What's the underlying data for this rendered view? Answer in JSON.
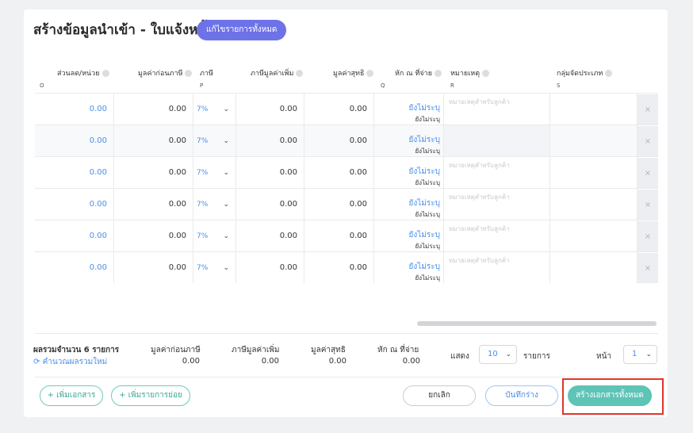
{
  "page": {
    "title": "สร้างข้อมูลนำเข้า - ใบแจ้งหนี้",
    "edit_all_button": "แก้ไขรายการทั้งหมด"
  },
  "table": {
    "headers": [
      {
        "label": "ส่วนลด/หน่วย",
        "letter": "O"
      },
      {
        "label": "มูลค่าก่อนภาษี",
        "letter": ""
      },
      {
        "label": "ภาษี",
        "letter": "P"
      },
      {
        "label": "ภาษีมูลค่าเพิ่ม",
        "letter": ""
      },
      {
        "label": "มูลค่าสุทธิ",
        "letter": ""
      },
      {
        "label": "หัก ณ ที่จ่าย",
        "letter": "Q"
      },
      {
        "label": "หมายเหตุ",
        "letter": "R"
      },
      {
        "label": "กลุ่มจัดประเภท",
        "letter": "S"
      }
    ],
    "rows": [
      {
        "discount": "0.00",
        "pretax": "0.00",
        "vat_rate": "7%",
        "vat": "0.00",
        "net": "0.00",
        "withholding": "ยังไม่ระบุ",
        "withholding_sub": "ยังไม่ระบุ",
        "note_placeholder": "หมายเหตุสำหรับลูกค้า",
        "delete": "×"
      },
      {
        "discount": "0.00",
        "pretax": "0.00",
        "vat_rate": "7%",
        "vat": "0.00",
        "net": "0.00",
        "withholding": "ยังไม่ระบุ",
        "withholding_sub": "ยังไม่ระบุ",
        "note_placeholder": "",
        "delete": "×"
      },
      {
        "discount": "0.00",
        "pretax": "0.00",
        "vat_rate": "7%",
        "vat": "0.00",
        "net": "0.00",
        "withholding": "ยังไม่ระบุ",
        "withholding_sub": "ยังไม่ระบุ",
        "note_placeholder": "หมายเหตุสำหรับลูกค้า",
        "delete": "×"
      },
      {
        "discount": "0.00",
        "pretax": "0.00",
        "vat_rate": "7%",
        "vat": "0.00",
        "net": "0.00",
        "withholding": "ยังไม่ระบุ",
        "withholding_sub": "ยังไม่ระบุ",
        "note_placeholder": "หมายเหตุสำหรับลูกค้า",
        "delete": "×"
      },
      {
        "discount": "0.00",
        "pretax": "0.00",
        "vat_rate": "7%",
        "vat": "0.00",
        "net": "0.00",
        "withholding": "ยังไม่ระบุ",
        "withholding_sub": "ยังไม่ระบุ",
        "note_placeholder": "หมายเหตุสำหรับลูกค้า",
        "delete": "×"
      },
      {
        "discount": "0.00",
        "pretax": "0.00",
        "vat_rate": "7%",
        "vat": "0.00",
        "net": "0.00",
        "withholding": "ยังไม่ระบุ",
        "withholding_sub": "ยังไม่ระบุ",
        "note_placeholder": "หมายเหตุสำหรับลูกค้า",
        "delete": "×"
      }
    ]
  },
  "summary": {
    "total_label": "ผลรวมจำนวน 6 รายการ",
    "recalc_label": "คำนวณผลรวมใหม่",
    "pretax_label": "มูลค่าก่อนภาษี",
    "pretax_value": "0.00",
    "vat_label": "ภาษีมูลค่าเพิ่ม",
    "vat_value": "0.00",
    "net_label": "มูลค่าสุทธิ",
    "net_value": "0.00",
    "withholding_label": "หัก ณ ที่จ่าย",
    "withholding_value": "0.00"
  },
  "pagination": {
    "show_label": "แสดง",
    "page_size": "10",
    "items_label": "รายการ",
    "page_label": "หน้า",
    "page": "1"
  },
  "actions": {
    "add_document": "+ เพิ่มเอกสาร",
    "add_subitem": "+ เพิ่มรายการย่อย",
    "cancel": "ยกเลิก",
    "save_draft": "บันทึกร่าง",
    "create_all": "สร้างเอกสารทั้งหมด"
  },
  "colors": {
    "accent_purple": "#6e72e8",
    "accent_teal": "#5ec4b6",
    "link_blue": "#4a8ee8",
    "highlight_red": "#e0352b"
  }
}
